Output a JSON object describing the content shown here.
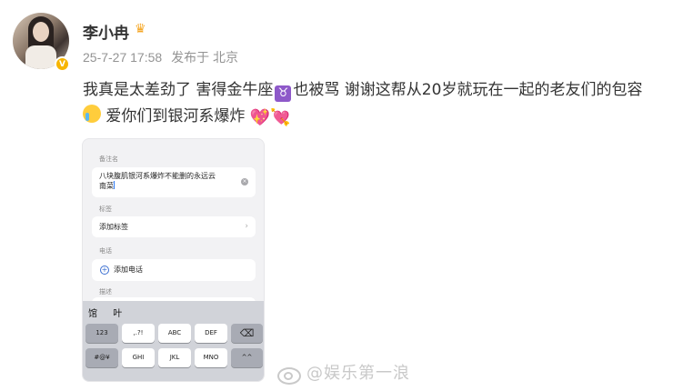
{
  "user": {
    "name": "李小冉",
    "crown_icon": "crown-icon",
    "verified_icon": "verified-v-badge",
    "verified_text": "V"
  },
  "meta": {
    "time": "25-7-27 17:58",
    "location": "发布于 北京"
  },
  "post": {
    "line1_a": "我真是太差劲了 害得金牛座",
    "zodiac_symbol": "♉",
    "line1_b": "也被骂 谢谢这帮从20岁就玩在一起的老友们的包容",
    "line2": "爱你们到银河系爆炸",
    "hearts": "💖💘"
  },
  "screenshot": {
    "note_label": "备注名",
    "note_value_1": "八块腹肌银河系爆炸不能删的永远云",
    "note_value_2": "南菜",
    "tag_label": "标签",
    "tag_value": "添加标签",
    "phone_label": "电话",
    "phone_value": "添加电话",
    "desc_label": "描述",
    "chevron": "›",
    "plus": "+",
    "clear": "×",
    "candidates": [
      "馆",
      "叶"
    ],
    "keys": {
      "k123": "123",
      "punct": ",.?!",
      "abc": "ABC",
      "def": "DEF",
      "delete": "⌫",
      "symbols": "#@¥",
      "ghi": "GHI",
      "jkl": "JKL",
      "mno": "MNO",
      "emoji": "^^"
    }
  },
  "watermark": {
    "text": "@娱乐第一浪"
  }
}
